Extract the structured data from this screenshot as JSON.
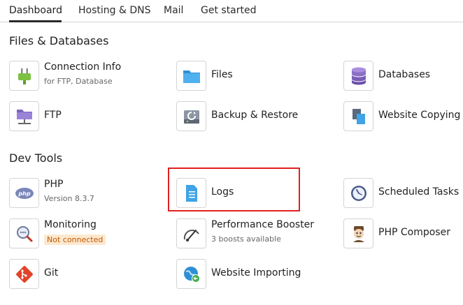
{
  "tabs": [
    {
      "label": "Dashboard",
      "active": true
    },
    {
      "label": "Hosting & DNS",
      "active": false
    },
    {
      "label": "Mail",
      "active": false
    },
    {
      "label": "Get started",
      "active": false
    }
  ],
  "sections": {
    "files": {
      "title": "Files & Databases",
      "items": [
        {
          "label": "Connection Info",
          "sub": "for FTP, Database",
          "icon": "plug-icon"
        },
        {
          "label": "Files",
          "icon": "folder-icon"
        },
        {
          "label": "Databases",
          "icon": "database-icon"
        },
        {
          "label": "FTP",
          "icon": "ftp-folder-icon"
        },
        {
          "label": "Backup & Restore",
          "icon": "backup-drive-icon"
        },
        {
          "label": "Website Copying",
          "icon": "copy-document-icon"
        }
      ]
    },
    "dev": {
      "title": "Dev Tools",
      "items": [
        {
          "label": "PHP",
          "sub": "Version 8.3.7",
          "icon": "php-icon"
        },
        {
          "label": "Logs",
          "icon": "log-document-icon"
        },
        {
          "label": "Scheduled Tasks",
          "icon": "clock-icon"
        },
        {
          "label": "Monitoring",
          "badge": "Not connected",
          "icon": "magnifier-icon"
        },
        {
          "label": "Performance Booster",
          "sub": "3 boosts available",
          "icon": "gauge-icon"
        },
        {
          "label": "PHP Composer",
          "icon": "composer-icon"
        },
        {
          "label": "Git",
          "icon": "git-icon"
        },
        {
          "label": "Website Importing",
          "icon": "globe-import-icon"
        }
      ]
    }
  },
  "colors": {
    "highlight": "#e02020",
    "badge_text": "#c05a00",
    "badge_bg": "#fde8cf",
    "folder_blue": "#3fa3e6",
    "database_purple": "#8b6fc6",
    "plug_green": "#7cc142"
  }
}
